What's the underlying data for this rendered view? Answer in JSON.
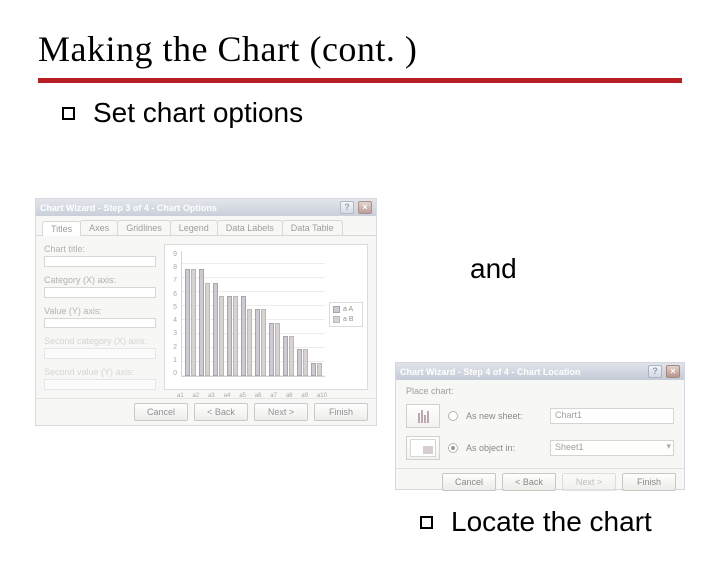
{
  "slide": {
    "title": "Making the Chart (cont. )",
    "bullet1": "Set chart options",
    "connector": "and",
    "bullet2": "Locate the chart"
  },
  "dialog1": {
    "title": "Chart Wizard - Step 3 of 4 - Chart Options",
    "tabs": [
      "Titles",
      "Axes",
      "Gridlines",
      "Legend",
      "Data Labels",
      "Data Table"
    ],
    "active_tab": 0,
    "labels": {
      "chart_title": "Chart title:",
      "category_axis": "Category (X) axis:",
      "value_axis": "Value (Y) axis:",
      "second_category": "Second category (X) axis:",
      "second_value": "Second value (Y) axis:"
    },
    "legend": {
      "series_a": "a A",
      "series_b": "a B"
    },
    "buttons": {
      "cancel": "Cancel",
      "back": "< Back",
      "next": "Next >",
      "finish": "Finish"
    }
  },
  "dialog2": {
    "title": "Chart Wizard - Step 4 of 4 - Chart Location",
    "section_label": "Place chart:",
    "options": {
      "new_sheet_label": "As new sheet:",
      "new_sheet_value": "Chart1",
      "object_in_label": "As object in:",
      "object_in_value": "Sheet1",
      "selected": "object_in"
    },
    "buttons": {
      "cancel": "Cancel",
      "back": "< Back",
      "next": "Next >",
      "finish": "Finish"
    }
  },
  "chart_data": {
    "type": "bar",
    "title": "",
    "xlabel": "",
    "ylabel": "",
    "ylim": [
      0,
      9
    ],
    "y_ticks": [
      0,
      1,
      2,
      3,
      4,
      5,
      6,
      7,
      8,
      9
    ],
    "categories": [
      "a1",
      "a2",
      "a3",
      "a4",
      "a5",
      "a6",
      "a7",
      "a8",
      "a9",
      "a10"
    ],
    "series": [
      {
        "name": "a A",
        "values": [
          8,
          8,
          7,
          6,
          6,
          5,
          4,
          3,
          2,
          1
        ],
        "color": "#c1a7cc"
      },
      {
        "name": "a B",
        "values": [
          8,
          7,
          6,
          6,
          5,
          5,
          4,
          3,
          2,
          1
        ],
        "color": "#d0b6b6"
      }
    ]
  }
}
